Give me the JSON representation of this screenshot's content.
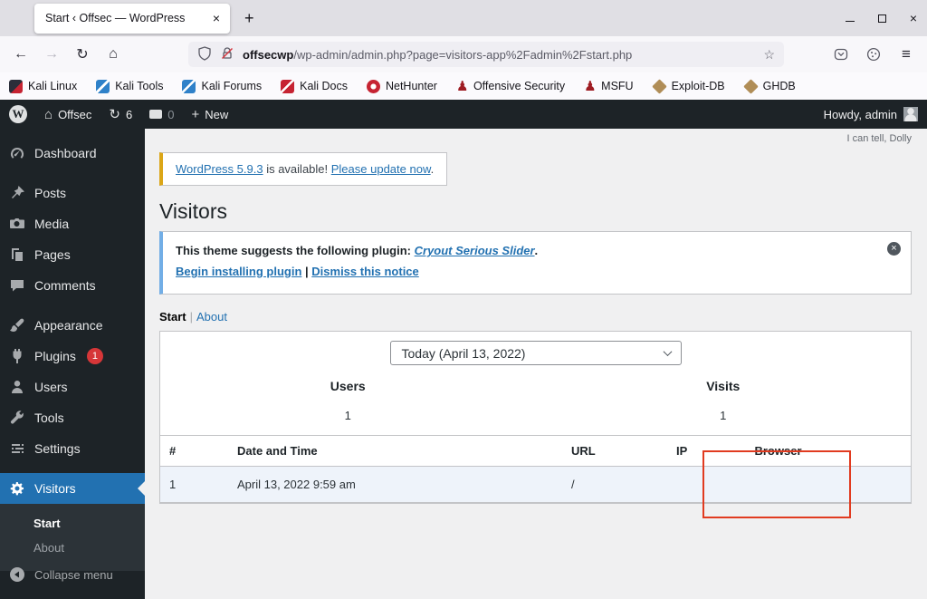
{
  "browser": {
    "tab_title": "Start ‹ Offsec — WordPress",
    "url": {
      "host": "offsecwp",
      "path": "/wp-admin/admin.php?page=visitors-app%2Fadmin%2Fstart.php"
    },
    "bookmarks": [
      {
        "label": "Kali Linux"
      },
      {
        "label": "Kali Tools"
      },
      {
        "label": "Kali Forums"
      },
      {
        "label": "Kali Docs"
      },
      {
        "label": "NetHunter"
      },
      {
        "label": "Offensive Security"
      },
      {
        "label": "MSFU"
      },
      {
        "label": "Exploit-DB"
      },
      {
        "label": "GHDB"
      }
    ]
  },
  "glyphs": {
    "close": "×",
    "plus": "+",
    "back": "←",
    "forward": "→",
    "reload": "↻",
    "home": "⌂",
    "star": "☆",
    "menu": "≡",
    "pawn": "♟",
    "wp": "W",
    "dismiss": "×"
  },
  "admin_bar": {
    "site_name": "Offsec",
    "update_count": "6",
    "comment_count": "0",
    "new_label": "New",
    "howdy": "Howdy, admin"
  },
  "sidebar": {
    "items": [
      {
        "label": "Dashboard"
      },
      {
        "label": "Posts"
      },
      {
        "label": "Media"
      },
      {
        "label": "Pages"
      },
      {
        "label": "Comments"
      },
      {
        "label": "Appearance"
      },
      {
        "label": "Plugins",
        "badge": "1"
      },
      {
        "label": "Users"
      },
      {
        "label": "Tools"
      },
      {
        "label": "Settings"
      },
      {
        "label": "Visitors"
      }
    ],
    "submenu": [
      {
        "label": "Start"
      },
      {
        "label": "About"
      }
    ],
    "collapse_label": "Collapse menu"
  },
  "content": {
    "dolly": "I can tell, Dolly",
    "update_notice": {
      "version_link": "WordPress 5.9.3",
      "middle": " is available! ",
      "action_link": "Please update now",
      "suffix": "."
    },
    "page_title": "Visitors",
    "theme_notice": {
      "prefix": "This theme suggests the following plugin: ",
      "plugin_link": "Cryout Serious Slider",
      "suffix": ".",
      "install_link": "Begin installing plugin",
      "divider": "|",
      "dismiss_link": "Dismiss this notice"
    },
    "views": {
      "current": "Start",
      "divider": "|",
      "other": "About"
    },
    "period_select_value": "Today (April 13, 2022)",
    "stats": [
      {
        "label": "Users",
        "value": "1"
      },
      {
        "label": "Visits",
        "value": "1"
      }
    ],
    "table": {
      "headers": [
        "#",
        "Date and Time",
        "URL",
        "IP",
        "Browser"
      ],
      "rows": [
        {
          "num": "1",
          "datetime": "April 13, 2022 9:59 am",
          "url": "/",
          "ip": "",
          "browser": ""
        }
      ]
    }
  },
  "colors": {
    "accent": "#2271b1",
    "badge_red": "#d63638",
    "update_nag_border": "#dba617",
    "notice_border": "#72aee6",
    "annotation_red": "#e13b20",
    "adminbar_bg": "#1d2327",
    "row_highlight": "#eef3fa"
  }
}
